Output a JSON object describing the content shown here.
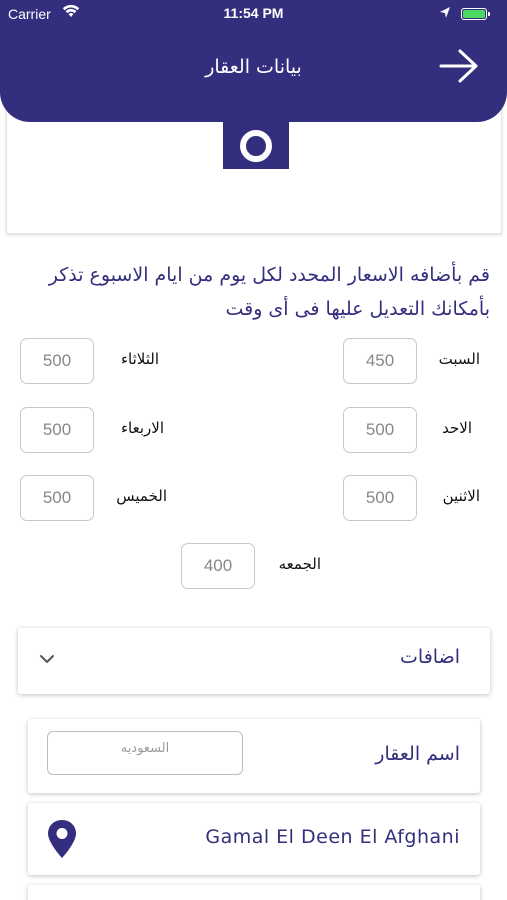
{
  "status_bar": {
    "carrier": "Carrier",
    "time": "11:54 PM"
  },
  "header": {
    "title": "بيانات العقار",
    "back_icon": "arrow-right-icon"
  },
  "photo": {
    "icon": "camera-icon"
  },
  "intro_text": "قم بأضافه الاسعار المحدد لكل يوم من ايام الاسبوع تذكر بأمكانك التعديل عليها فى أى وقت",
  "prices": {
    "saturday": {
      "label": "السبت",
      "value": "450"
    },
    "sunday": {
      "label": "الاحد",
      "value": "500"
    },
    "monday": {
      "label": "الاثنين",
      "value": "500"
    },
    "tuesday": {
      "label": "الثلاثاء",
      "value": "500"
    },
    "wednesday": {
      "label": "الاربعاء",
      "value": "500"
    },
    "thursday": {
      "label": "الخميس",
      "value": "500"
    },
    "friday": {
      "label": "الجمعه",
      "value": "400"
    }
  },
  "extras": {
    "label": "اضافات",
    "icon": "chevron-down-icon"
  },
  "property_name": {
    "label": "اسم العقار",
    "value": "السعوديه"
  },
  "location": {
    "address": "Gamal El Deen El Afghani",
    "icon": "map-pin-icon"
  },
  "colors": {
    "primary": "#332f7e",
    "battery": "#4cd964"
  }
}
